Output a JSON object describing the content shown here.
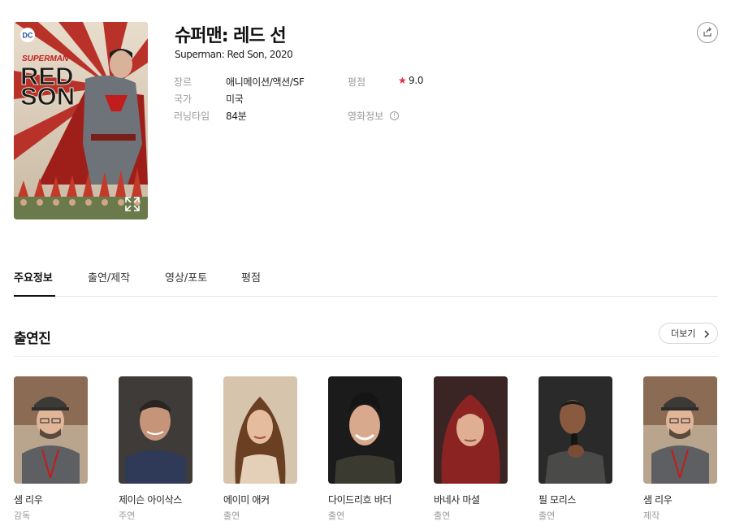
{
  "movie": {
    "title": "슈퍼맨: 레드 선",
    "subtitle": "Superman: Red Son, 2020",
    "poster_alt": "SUPERMAN RED SON poster",
    "poster_brand": "DC",
    "poster_wordmark_top": "SUPERMAN",
    "poster_wordmark_1": "RED",
    "poster_wordmark_2": "SON"
  },
  "info": {
    "genre_label": "장르",
    "genre_value": "애니메이션/액션/SF",
    "country_label": "국가",
    "country_value": "미국",
    "runtime_label": "러닝타임",
    "runtime_value": "84분",
    "rating_label": "평점",
    "rating_star": "★",
    "rating_value": "9.0",
    "movieinfo_label": "영화정보",
    "movieinfo_icon": "!"
  },
  "tabs": [
    {
      "label": "주요정보",
      "active": true
    },
    {
      "label": "출연/제작",
      "active": false
    },
    {
      "label": "영상/포토",
      "active": false
    },
    {
      "label": "평점",
      "active": false
    }
  ],
  "cast_section": {
    "title": "출연진",
    "more_label": "더보기"
  },
  "cast": [
    {
      "name": "샘 리우",
      "role": "감독"
    },
    {
      "name": "제이슨 아이삭스",
      "role": "주연"
    },
    {
      "name": "에이미 애커",
      "role": "출연"
    },
    {
      "name": "다이드리흐 바더",
      "role": "출연"
    },
    {
      "name": "바네사 마셜",
      "role": "출연"
    },
    {
      "name": "필 모리스",
      "role": "출연"
    },
    {
      "name": "샘 리우",
      "role": "제작"
    }
  ],
  "colors": {
    "star": "#e8284a",
    "poster_red": "#b5413a"
  }
}
